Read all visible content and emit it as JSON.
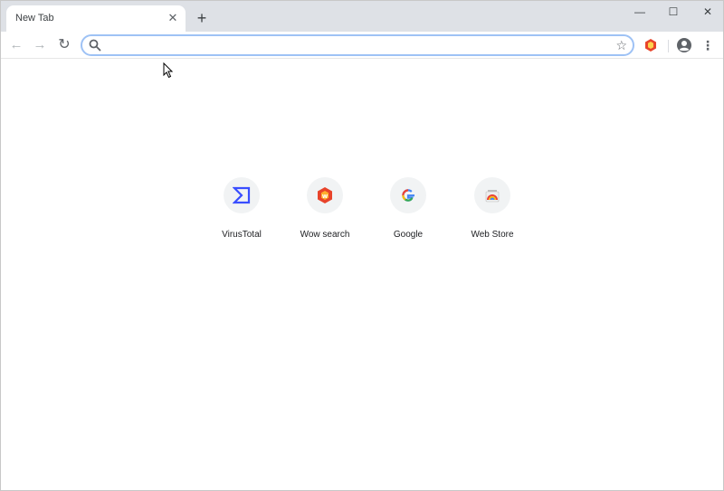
{
  "window": {
    "controls": {
      "minimize": "—",
      "maximize": "☐",
      "close": "✕"
    }
  },
  "tabs": [
    {
      "title": "New Tab",
      "close": "✕"
    }
  ],
  "new_tab_button": "+",
  "toolbar": {
    "back": "←",
    "forward": "→",
    "reload": "↻",
    "omnibox": {
      "value": "",
      "placeholder": ""
    },
    "bookmark_star": "☆",
    "menu": "⋮"
  },
  "shortcuts": [
    {
      "label": "VirusTotal",
      "icon": "virustotal-icon"
    },
    {
      "label": "Wow search",
      "icon": "wow-search-icon"
    },
    {
      "label": "Google",
      "icon": "google-icon"
    },
    {
      "label": "Web Store",
      "icon": "web-store-icon"
    }
  ],
  "colors": {
    "tabstrip": "#dee1e6",
    "omnibox_focus": "#9ec2f5",
    "virustotal": "#394eff",
    "wow": "#e8442b"
  }
}
